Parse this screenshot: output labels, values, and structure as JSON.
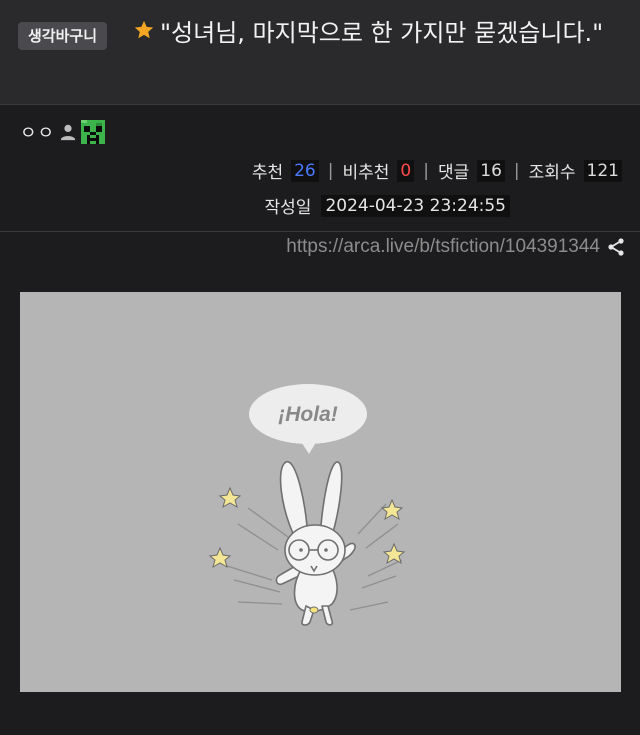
{
  "post": {
    "category": "생각바구니",
    "title": "\"성녀님, 마지막으로 한 가지만 묻겠습니다.\"",
    "author": "ㅇㅇ"
  },
  "stats": {
    "recommend_label": "추천",
    "recommend_value": "26",
    "dislike_label": "비추천",
    "dislike_value": "0",
    "comments_label": "댓글",
    "comments_value": "16",
    "views_label": "조회수",
    "views_value": "121",
    "separator": "|"
  },
  "date": {
    "label": "작성일",
    "value": "2024-04-23 23:24:55"
  },
  "url": "https://arca.live/b/tsfiction/104391344",
  "illustration": {
    "bubble_text": "¡Hola!"
  },
  "colors": {
    "recommend": "#4a7bff",
    "dislike": "#ff4a4a",
    "star": "#f5a623",
    "avatar": "#3cb44b"
  },
  "icons": [
    "star-icon",
    "person-icon",
    "creeper-avatar-icon",
    "share-icon"
  ]
}
